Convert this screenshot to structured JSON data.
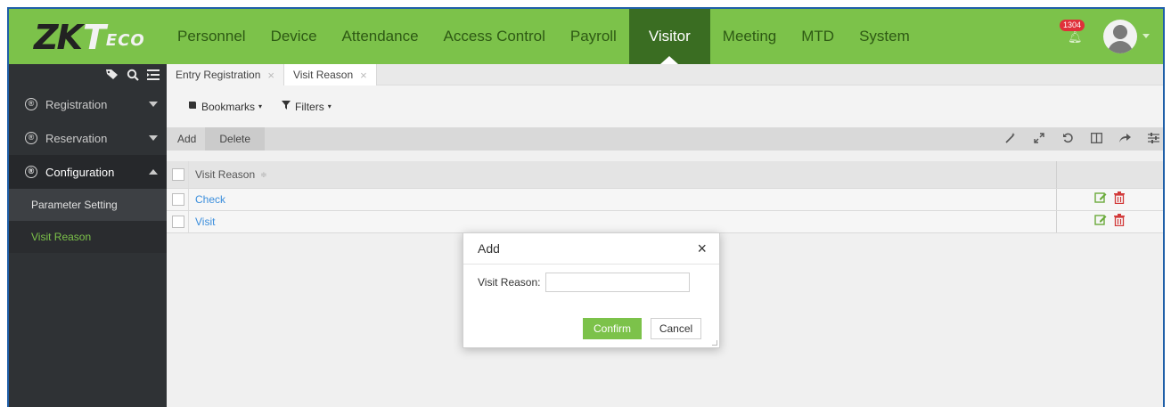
{
  "brand": {
    "logo_zk": "ZK",
    "logo_t": "T",
    "logo_eco": "ECO"
  },
  "nav": {
    "items": [
      {
        "label": "Personnel"
      },
      {
        "label": "Device"
      },
      {
        "label": "Attendance"
      },
      {
        "label": "Access Control"
      },
      {
        "label": "Payroll"
      },
      {
        "label": "Visitor"
      },
      {
        "label": "Meeting"
      },
      {
        "label": "MTD"
      },
      {
        "label": "System"
      }
    ],
    "active": "Visitor",
    "notification_count": "1304"
  },
  "sidebar": {
    "groups": [
      {
        "label": "Registration",
        "badge": "®"
      },
      {
        "label": "Reservation",
        "badge": "®"
      },
      {
        "label": "Configuration",
        "badge": "®"
      }
    ],
    "sub_items": [
      {
        "label": "Parameter Setting"
      },
      {
        "label": "Visit Reason"
      }
    ],
    "active_sub": "Visit Reason"
  },
  "tabs": [
    {
      "label": "Entry Registration",
      "close": "×"
    },
    {
      "label": "Visit Reason",
      "close": "×"
    }
  ],
  "filterbar": {
    "bookmarks": "Bookmarks",
    "filters": "Filters"
  },
  "toolbar": {
    "add": "Add",
    "delete": "Delete"
  },
  "grid": {
    "column_header": "Visit Reason",
    "sort_glyph": "≑",
    "rows": [
      {
        "visit_reason": "Check"
      },
      {
        "visit_reason": "Visit"
      }
    ]
  },
  "modal": {
    "title": "Add",
    "close": "×",
    "field_label": "Visit Reason:",
    "field_value": "",
    "confirm": "Confirm",
    "cancel": "Cancel"
  },
  "colors": {
    "accent": "#7cc24a",
    "nav_active": "#3a6d22",
    "sidebar_bg": "#2f3235",
    "link": "#3b8edc",
    "delete_red": "#d23a3a"
  }
}
